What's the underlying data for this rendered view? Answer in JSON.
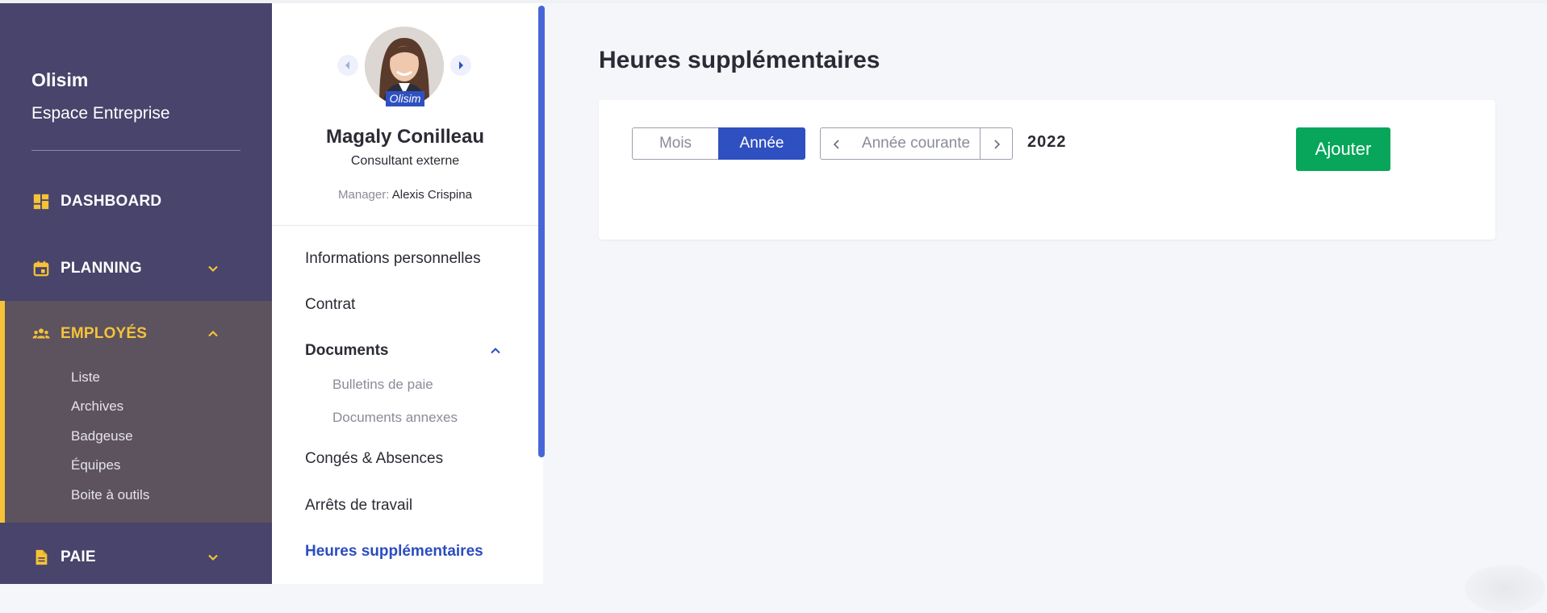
{
  "sidebar": {
    "brand": "Olisim",
    "subtitle": "Espace Entreprise",
    "items": [
      {
        "label": "DASHBOARD",
        "icon": "dashboard-icon"
      },
      {
        "label": "PLANNING",
        "icon": "calendar-icon"
      },
      {
        "label": "EMPLOYÉS",
        "icon": "people-icon",
        "active": true,
        "subitems": [
          "Liste",
          "Archives",
          "Badgeuse",
          "Équipes",
          "Boite à outils"
        ]
      },
      {
        "label": "PAIE",
        "icon": "document-icon"
      }
    ],
    "accent_color": "#f6c338",
    "background_color": "#48446b"
  },
  "employee": {
    "name": "Magaly Conilleau",
    "role": "Consultant externe",
    "manager_label": "Manager:",
    "manager_name": "Alexis Crispina",
    "company_tag": "Olisim"
  },
  "employee_menu": {
    "items": [
      {
        "label": "Informations personnelles"
      },
      {
        "label": "Contrat"
      },
      {
        "label": "Documents",
        "expanded": true,
        "subitems": [
          "Bulletins de paie",
          "Documents annexes"
        ]
      },
      {
        "label": "Congés & Absences"
      },
      {
        "label": "Arrêts de travail"
      },
      {
        "label": "Heures supplémentaires",
        "active": true
      }
    ]
  },
  "main": {
    "title": "Heures supplémentaires",
    "period_toggle": {
      "options": [
        "Mois",
        "Année"
      ],
      "selected": "Année"
    },
    "pager": {
      "label": "Année courante"
    },
    "year": "2022",
    "add_button": "Ajouter",
    "primary_color": "#2f50c0",
    "success_color": "#07a65a"
  }
}
